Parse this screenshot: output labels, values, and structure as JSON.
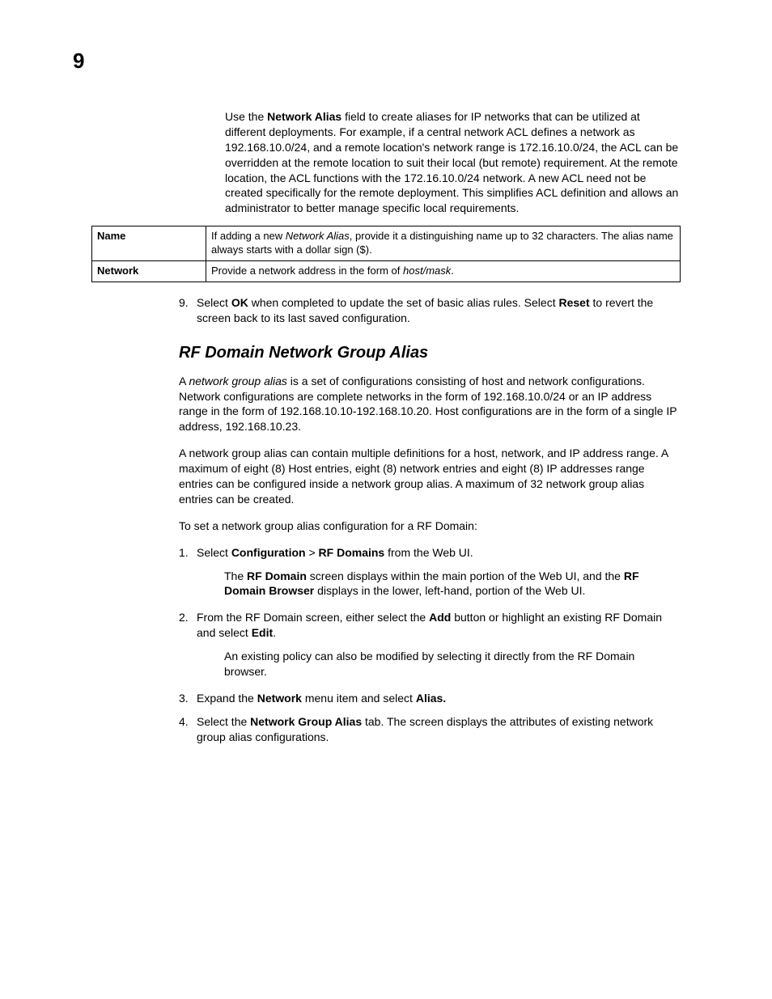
{
  "page_number": "9",
  "intro": {
    "pre": "Use the ",
    "bold": "Network Alias",
    "post": " field to create aliases for IP networks that can be utilized at different deployments. For example, if a central network ACL defines a network as 192.168.10.0/24, and a remote location's network range is 172.16.10.0/24, the ACL can be overridden at the remote location to suit their local (but remote) requirement. At the remote location, the ACL functions with the 172.16.10.0/24 network. A new ACL need not be created specifically for the remote deployment. This simplifies ACL definition and allows an administrator to better manage specific local requirements."
  },
  "table": {
    "row1": {
      "label": "Name",
      "pre": "If adding a new ",
      "italic": "Network Alias",
      "post": ", provide it a distinguishing name up to 32 characters. The alias name always starts with a dollar sign ($)."
    },
    "row2": {
      "label": "Network",
      "pre": "Provide a network address in the form of ",
      "italic": "host/mask",
      "post": "."
    }
  },
  "step9": {
    "num": "9.",
    "pre": "Select ",
    "b1": "OK",
    "mid": " when completed to update the set of basic alias rules. Select ",
    "b2": "Reset",
    "post": " to revert the screen back to its last saved configuration."
  },
  "heading": "RF Domain Network Group Alias",
  "para1": {
    "pre": "A ",
    "italic": "network group alias",
    "post": " is a set of configurations consisting of host and network configurations. Network configurations are complete networks in the form of 192.168.10.0/24 or an IP address range in the form of 192.168.10.10-192.168.10.20. Host configurations are in the form of a single IP address, 192.168.10.23."
  },
  "para2": "A network group alias can contain multiple definitions for a host, network, and IP address range. A maximum of eight (8) Host entries, eight (8) network entries and eight (8) IP addresses range entries can be configured inside a network group alias. A maximum of 32 network group alias entries can be created.",
  "para3": "To set a network group alias configuration for a RF Domain:",
  "s1": {
    "num": "1.",
    "pre": "Select ",
    "b1": "Configuration",
    "mid1": " > ",
    "b2": "RF Domains",
    "post": " from the Web UI."
  },
  "s1sub": {
    "pre": "The ",
    "b1": "RF Domain",
    "mid": " screen displays within the main portion of the Web UI, and the ",
    "b2": "RF Domain Browser",
    "post": " displays in the lower, left-hand, portion of the Web UI."
  },
  "s2": {
    "num": "2.",
    "pre": "From the RF Domain screen, either select the ",
    "b1": "Add",
    "mid": " button or highlight an existing RF Domain and select ",
    "b2": "Edit",
    "post": "."
  },
  "s2sub": "An existing policy can also be modified by selecting it directly from the RF Domain browser.",
  "s3": {
    "num": "3.",
    "pre": "Expand the ",
    "b1": "Network",
    "mid": " menu item and select ",
    "b2": "Alias.",
    "post": ""
  },
  "s4": {
    "num": "4.",
    "pre": "Select the ",
    "b1": "Network Group Alias",
    "post": " tab. The screen displays the attributes of existing network group alias configurations."
  }
}
